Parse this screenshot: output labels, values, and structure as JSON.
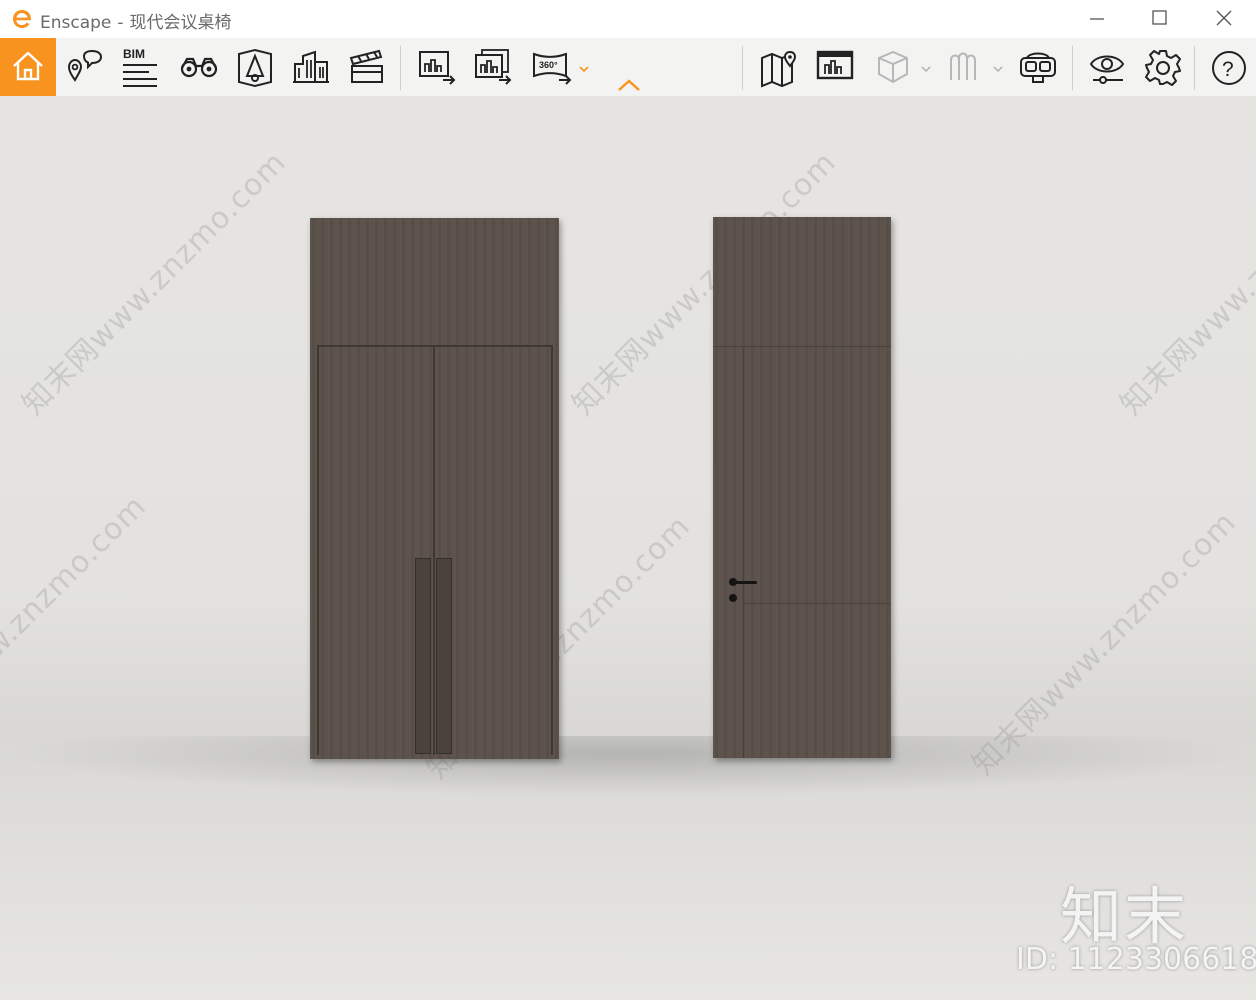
{
  "window": {
    "app_name": "Enscape",
    "separator": "-",
    "document_title": "现代会议桌椅",
    "controls": {
      "minimize": "minimize-icon",
      "maximize": "maximize-icon",
      "close": "close-icon"
    }
  },
  "toolbar": {
    "accent_color": "#f7931e",
    "buttons": [
      {
        "icon": "home-icon",
        "label": ""
      },
      {
        "icon": "location-chat-icon",
        "label": ""
      },
      {
        "icon": "bim-list-icon",
        "label": "BIM"
      },
      {
        "icon": "binoculars-icon",
        "label": ""
      },
      {
        "icon": "perspective-cone-icon",
        "label": ""
      },
      {
        "icon": "buildings-icon",
        "label": ""
      },
      {
        "icon": "clapperboard-icon",
        "label": ""
      },
      {
        "icon": "export-image-icon",
        "label": ""
      },
      {
        "icon": "batch-export-icon",
        "label": ""
      },
      {
        "icon": "panorama-export-icon",
        "label": "360°"
      },
      {
        "icon": "map-pin-icon",
        "label": ""
      },
      {
        "icon": "gallery-icon",
        "label": ""
      },
      {
        "icon": "cube-icon",
        "label": ""
      },
      {
        "icon": "standalone-icon",
        "label": ""
      },
      {
        "icon": "vr-headset-icon",
        "label": ""
      },
      {
        "icon": "visual-settings-icon",
        "label": ""
      },
      {
        "icon": "gear-icon",
        "label": ""
      },
      {
        "icon": "help-icon",
        "label": "?"
      }
    ]
  },
  "overlay": {
    "watermark_text": "知末网www.znzmo.com",
    "brand": "知末",
    "image_id": "ID: 1123306618"
  }
}
